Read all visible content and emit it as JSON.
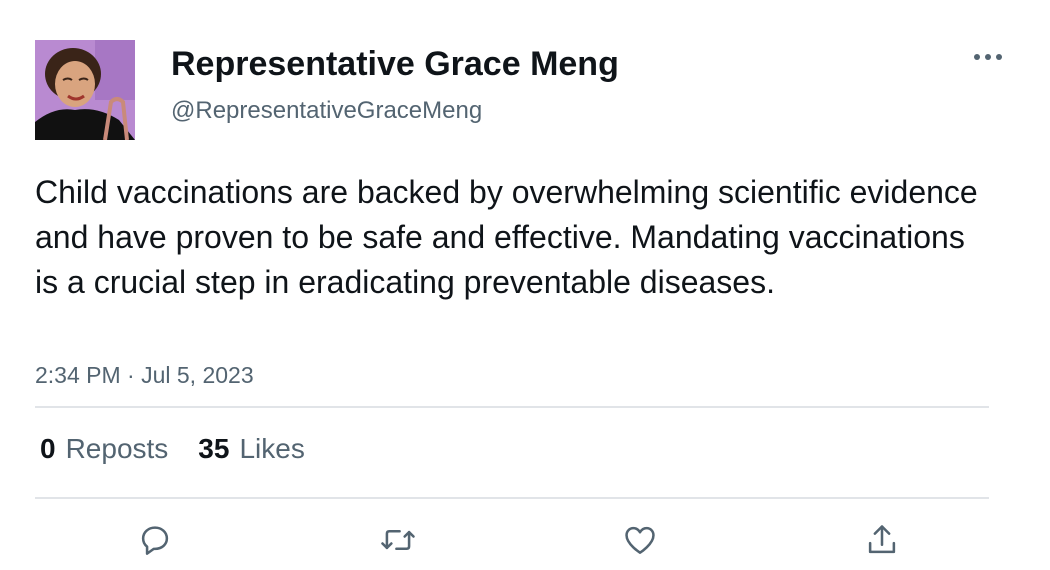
{
  "author": {
    "display_name": "Representative Grace Meng",
    "handle": "@RepresentativeGraceMeng"
  },
  "tweet": {
    "text": "Child vaccinations are backed by overwhelming scientific evidence and have proven to be safe and effective. Mandating vaccinations is a crucial step in eradicating preventable diseases.",
    "timestamp": "2:34 PM · Jul 5, 2023"
  },
  "stats": {
    "reposts_count": "0",
    "reposts_label": "Reposts",
    "likes_count": "35",
    "likes_label": "Likes"
  },
  "icons": {
    "more": "more-horizontal-icon",
    "reply": "reply-icon",
    "repost": "repost-icon",
    "like": "heart-icon",
    "share": "share-icon"
  },
  "colors": {
    "text_primary": "#0f1419",
    "text_secondary": "#536471",
    "icon": "#536471",
    "divider": "#e1e4e8",
    "avatar_background": "#b98ad1"
  }
}
